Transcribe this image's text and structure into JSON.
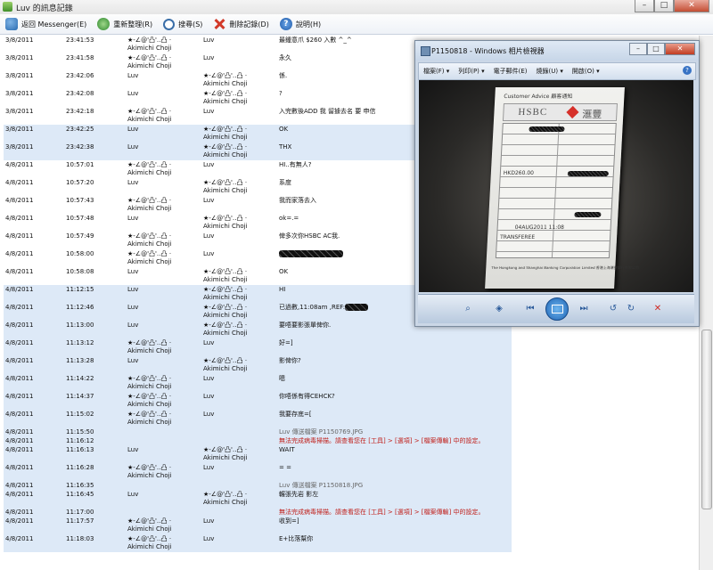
{
  "window": {
    "title": "Luv 的訊息記錄"
  },
  "toolbar": {
    "back_label": "返回 Messenger(E)",
    "refresh_label": "重新整理(R)",
    "search_label": "搜尋(S)",
    "delete_label": "刪除記錄(D)",
    "help_label": "說明(H)"
  },
  "names": {
    "self_line1": "★-∠@'凸'‥凸 ·",
    "self_line2": "Akimichi Choji",
    "luv": "Luv"
  },
  "log": [
    {
      "date": "3/8/2011",
      "time": "23:41:53",
      "from": "self",
      "to": "luv",
      "msg": "最鍾意爪 $260 入數 ^_^",
      "shade": false
    },
    {
      "date": "3/8/2011",
      "time": "23:41:58",
      "from": "self",
      "to": "luv",
      "msg": "永久",
      "shade": false
    },
    {
      "date": "3/8/2011",
      "time": "23:42:06",
      "from": "luv",
      "to": "self",
      "msg": "係.",
      "shade": false
    },
    {
      "date": "3/8/2011",
      "time": "23:42:08",
      "from": "luv",
      "to": "self",
      "msg": "?",
      "shade": false
    },
    {
      "date": "3/8/2011",
      "time": "23:42:18",
      "from": "self",
      "to": "luv",
      "msg": "入完數後ADD 我 留據去名 要 申信",
      "shade": false
    },
    {
      "date": "3/8/2011",
      "time": "23:42:25",
      "from": "luv",
      "to": "self",
      "msg": "OK",
      "shade": true
    },
    {
      "date": "3/8/2011",
      "time": "23:42:38",
      "from": "luv",
      "to": "self",
      "msg": "THX",
      "shade": true
    },
    {
      "date": "4/8/2011",
      "time": "10:57:01",
      "from": "self",
      "to": "luv",
      "msg": "HI..有無人?",
      "shade": false
    },
    {
      "date": "4/8/2011",
      "time": "10:57:20",
      "from": "luv",
      "to": "self",
      "msg": "系度",
      "shade": false
    },
    {
      "date": "4/8/2011",
      "time": "10:57:43",
      "from": "self",
      "to": "luv",
      "msg": "我而家落去入",
      "shade": false
    },
    {
      "date": "4/8/2011",
      "time": "10:57:48",
      "from": "luv",
      "to": "self",
      "msg": "ok=.=",
      "shade": false
    },
    {
      "date": "4/8/2011",
      "time": "10:57:49",
      "from": "self",
      "to": "luv",
      "msg": "俾多次你HSBC AC我.",
      "shade": false
    },
    {
      "date": "4/8/2011",
      "time": "10:58:00",
      "from": "self",
      "to": "luv",
      "msg": "",
      "scribble": "large",
      "shade": false
    },
    {
      "date": "4/8/2011",
      "time": "10:58:08",
      "from": "luv",
      "to": "self",
      "msg": "OK",
      "shade": false
    },
    {
      "date": "4/8/2011",
      "time": "11:12:15",
      "from": "luv",
      "to": "self",
      "msg": "HI",
      "shade": true
    },
    {
      "date": "4/8/2011",
      "time": "11:12:46",
      "from": "luv",
      "to": "self",
      "msg": "已過數,11:08am ,REF:",
      "scribble": "small",
      "shade": true
    },
    {
      "date": "4/8/2011",
      "time": "11:13:00",
      "from": "luv",
      "to": "self",
      "msg": "要唔要影張單俾你.",
      "shade": true
    },
    {
      "date": "4/8/2011",
      "time": "11:13:12",
      "from": "self",
      "to": "luv",
      "msg": "好=]",
      "shade": true
    },
    {
      "date": "4/8/2011",
      "time": "11:13:28",
      "from": "luv",
      "to": "self",
      "msg": "影俾你?",
      "shade": true
    },
    {
      "date": "4/8/2011",
      "time": "11:14:22",
      "from": "self",
      "to": "luv",
      "msg": "嗯",
      "shade": true
    },
    {
      "date": "4/8/2011",
      "time": "11:14:37",
      "from": "self",
      "to": "luv",
      "msg": "你唔係有得CEHCK?",
      "shade": true
    },
    {
      "date": "4/8/2011",
      "time": "11:15:02",
      "from": "self",
      "to": "luv",
      "msg": "我要存底=[",
      "shade": true
    },
    {
      "date": "4/8/2011",
      "time": "11:15:50",
      "from": "",
      "to": "",
      "msg": "Luv 傳送檔案 P1150769.JPG",
      "style": "gray",
      "shade": true,
      "short": true
    },
    {
      "date": "4/8/2011",
      "time": "11:16:12",
      "from": "",
      "to": "",
      "msg": "無法完成病毒掃描。請查看您在 [工具] > [選項] > [檔案傳輸] 中的設定。",
      "style": "red",
      "shade": true,
      "short": true
    },
    {
      "date": "4/8/2011",
      "time": "11:16:13",
      "from": "luv",
      "to": "self",
      "msg": "WAIT",
      "shade": true
    },
    {
      "date": "4/8/2011",
      "time": "11:16:28",
      "from": "self",
      "to": "luv",
      "msg": "= =",
      "shade": true
    },
    {
      "date": "4/8/2011",
      "time": "11:16:35",
      "from": "",
      "to": "",
      "msg": "Luv 傳送檔案 P1150818.JPG",
      "style": "gray",
      "shade": true,
      "short": true
    },
    {
      "date": "4/8/2011",
      "time": "11:16:45",
      "from": "luv",
      "to": "self",
      "msg": "輾張先岩 影左",
      "shade": true
    },
    {
      "date": "4/8/2011",
      "time": "11:17:00",
      "from": "",
      "to": "",
      "msg": "無法完成病毒掃描。請查看您在 [工具] > [選項] > [檔案傳輸] 中的設定。",
      "style": "red",
      "shade": true,
      "short": true
    },
    {
      "date": "4/8/2011",
      "time": "11:17:57",
      "from": "self",
      "to": "luv",
      "msg": "收到=]",
      "shade": true
    },
    {
      "date": "4/8/2011",
      "time": "11:18:03",
      "from": "self",
      "to": "luv",
      "msg": "E+比落幫你",
      "shade": true
    }
  ],
  "viewer": {
    "title": "P1150818 - Windows 相片檢視器",
    "menu": [
      "檔案(F) ▾",
      "列印(P) ▾",
      "電子郵件(E)",
      "燒錄(U) ▾",
      "開啟(O) ▾"
    ],
    "receipt": {
      "header": "Customer Advice 顧客通知",
      "bank": "HSBC",
      "bank_cn": "滙豐",
      "currency": "HKD260.00",
      "date": "04AUG2011 11:08",
      "transfer": "TRANSFEREE",
      "footer": "The Hongkong and Shanghai Banking Corporation Limited 香港上海滙豐銀行有限公司"
    }
  }
}
